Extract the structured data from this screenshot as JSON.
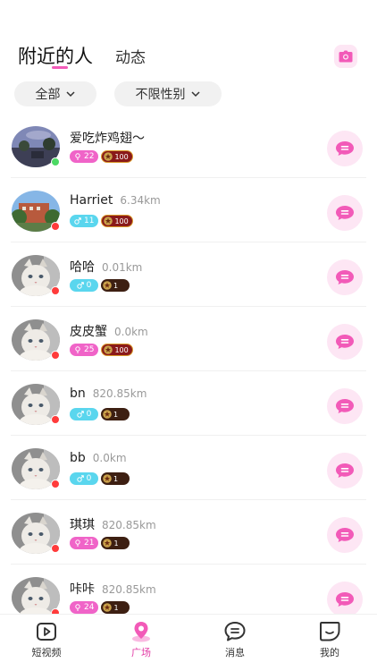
{
  "header": {
    "tab_nearby": "附近的人",
    "tab_moments": "动态"
  },
  "filters": {
    "all": "全部",
    "gender": "不限性别"
  },
  "colors": {
    "accent": "#f25ab8",
    "female_badge": "#f064c8",
    "male_badge": "#5ad6ee",
    "online": "#4cd964",
    "offline": "#ff3b3b"
  },
  "users": [
    {
      "name": "爱吃炸鸡翅～",
      "distance": "",
      "gender": "female",
      "count": "22",
      "level": "100",
      "status": "online",
      "avatar": "sky"
    },
    {
      "name": "Harriet",
      "distance": "6.34km",
      "gender": "male",
      "count": "11",
      "level": "100",
      "status": "offline",
      "avatar": "building"
    },
    {
      "name": "哈哈",
      "distance": "0.01km",
      "gender": "male",
      "count": "0",
      "level": "1",
      "status": "offline",
      "avatar": "cat"
    },
    {
      "name": "皮皮蟹",
      "distance": "0.0km",
      "gender": "female",
      "count": "25",
      "level": "100",
      "status": "offline",
      "avatar": "cat"
    },
    {
      "name": "bn",
      "distance": "820.85km",
      "gender": "male",
      "count": "0",
      "level": "1",
      "status": "offline",
      "avatar": "cat"
    },
    {
      "name": "bb",
      "distance": "0.0km",
      "gender": "male",
      "count": "0",
      "level": "1",
      "status": "offline",
      "avatar": "cat"
    },
    {
      "name": "琪琪",
      "distance": "820.85km",
      "gender": "female",
      "count": "21",
      "level": "1",
      "status": "offline",
      "avatar": "cat"
    },
    {
      "name": "咔咔",
      "distance": "820.85km",
      "gender": "female",
      "count": "24",
      "level": "1",
      "status": "offline",
      "avatar": "cat"
    }
  ],
  "nav": {
    "video": "短视频",
    "square": "广场",
    "messages": "消息",
    "mine": "我的",
    "active": "square"
  }
}
